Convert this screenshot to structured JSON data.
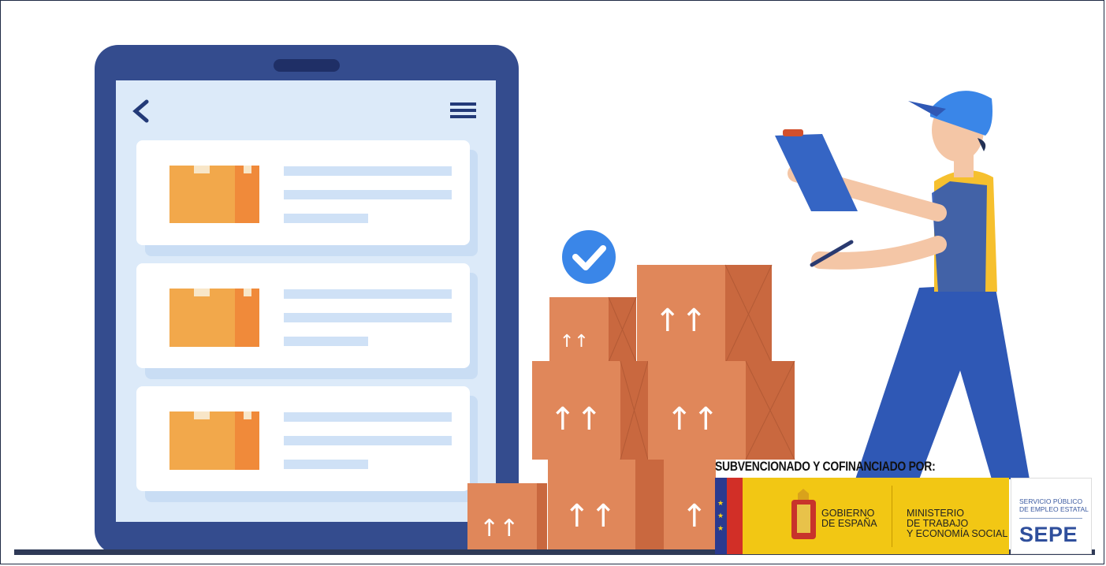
{
  "logos": {
    "subsidy_label": "SUBVENCIONADO Y COFINANCIADO POR:",
    "gobierno_line1": "GOBIERNO",
    "gobierno_line2": "DE ESPAÑA",
    "ministerio_line1": "MINISTERIO",
    "ministerio_line2": "DE TRABAJO",
    "ministerio_line3": "Y ECONOMÍA SOCIAL",
    "sepe_line1": "SERVICIO PÚBLICO",
    "sepe_line2": "DE EMPLEO ESTATAL",
    "sepe_acronym": "SEPE"
  },
  "colors": {
    "tablet_frame": "#344c8e",
    "tablet_screen": "#dceaf9",
    "box_orange": "#f2a84b",
    "cardboard": "#e0875a",
    "check_blue": "#3a86e8",
    "worker_blue": "#2f58b5",
    "worker_yellow": "#f6c02e"
  }
}
